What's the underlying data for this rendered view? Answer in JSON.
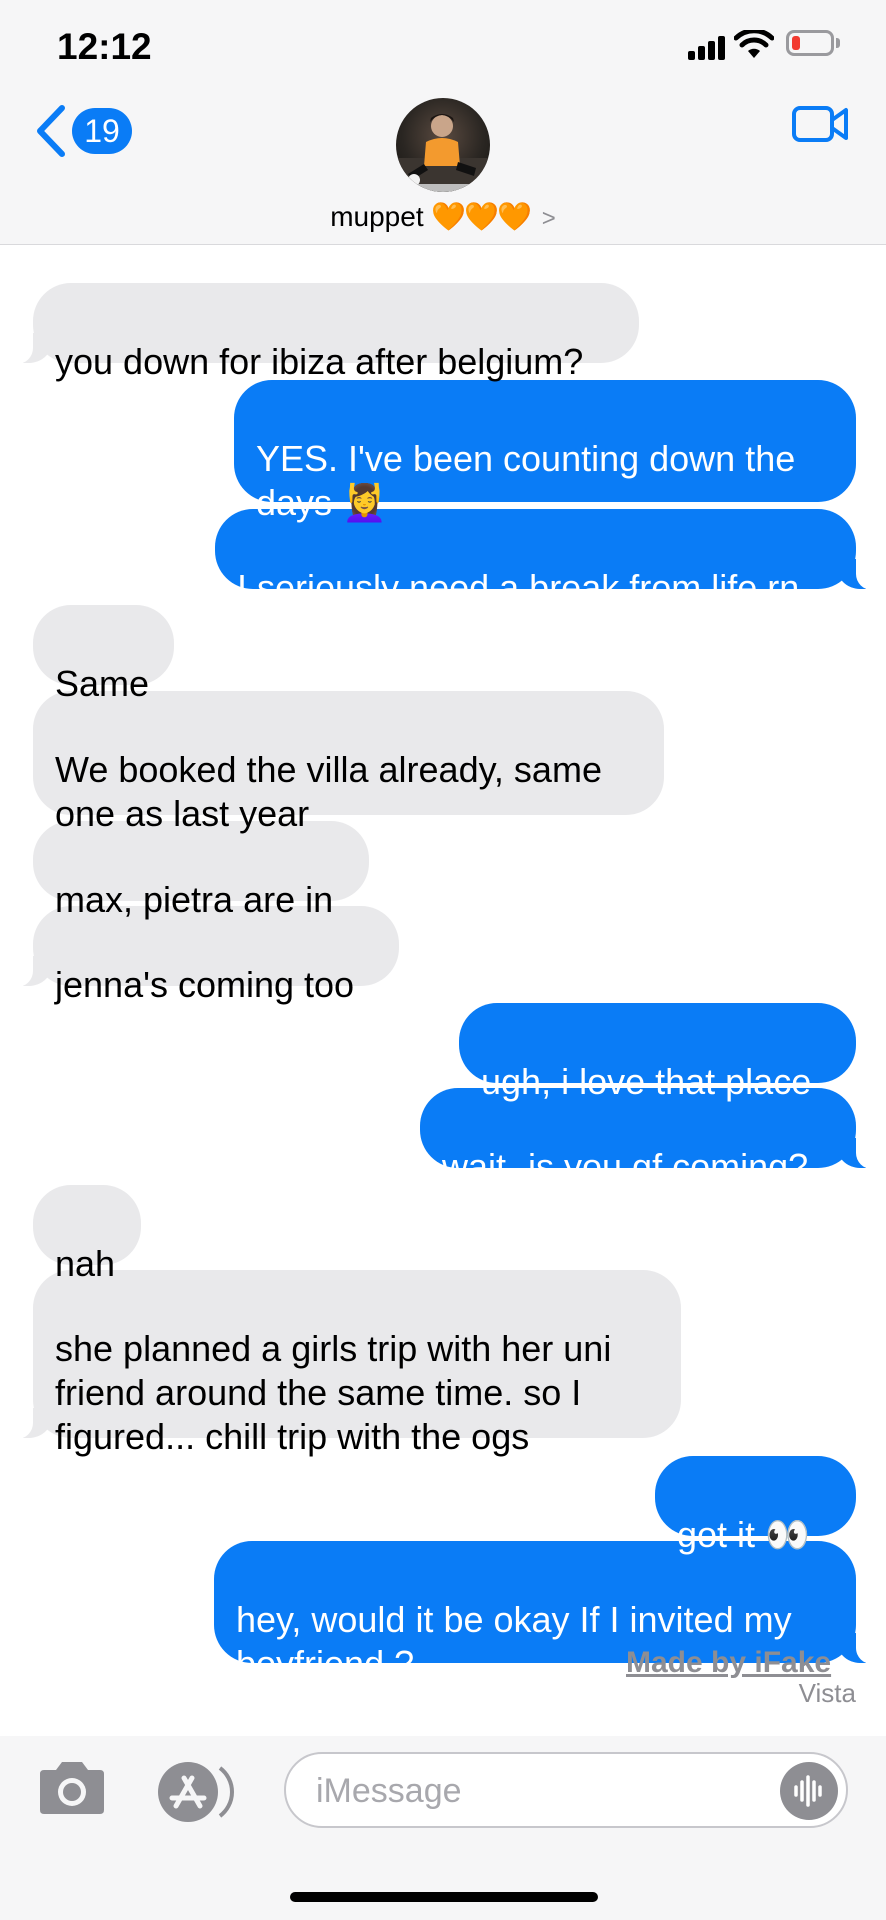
{
  "status": {
    "time": "12:12"
  },
  "header": {
    "back_count": "19",
    "contact_name": "muppet",
    "contact_hearts": "🧡🧡🧡",
    "contact_chevron": ">"
  },
  "messages": [
    {
      "from": "them",
      "text": "you down for ibiza after belgium?"
    },
    {
      "from": "me",
      "text": "YES. I've been counting down the days 💆‍♀️"
    },
    {
      "from": "me",
      "text": "I seriously need a break from life rn"
    },
    {
      "from": "them",
      "text": "Same"
    },
    {
      "from": "them",
      "text": "We booked the villa already, same one as last year"
    },
    {
      "from": "them",
      "text": "max, pietra are in"
    },
    {
      "from": "them",
      "text": "jenna's coming too"
    },
    {
      "from": "me",
      "text": "ugh, i love that place"
    },
    {
      "from": "me",
      "text": "wait- is you gf coming?"
    },
    {
      "from": "them",
      "text": "nah"
    },
    {
      "from": "them",
      "text": "she planned a girls trip with her uni friend around the same time. so I figured... chill trip with the ogs"
    },
    {
      "from": "me",
      "text": "got it 👀"
    },
    {
      "from": "me",
      "text": "hey, would it be okay If I invited my boyfriend ?"
    }
  ],
  "watermark": {
    "line1": "Made by iFake",
    "line2": "Vista"
  },
  "input": {
    "placeholder": "iMessage"
  },
  "colors": {
    "sent": "#0a7cf6",
    "received": "#e9e9eb",
    "header_bg": "#f6f6f7"
  },
  "icons": [
    "back-chevron-icon",
    "video-camera-icon",
    "camera-icon",
    "app-store-icon",
    "audio-wave-icon",
    "signal-icon",
    "wifi-icon",
    "battery-icon"
  ]
}
